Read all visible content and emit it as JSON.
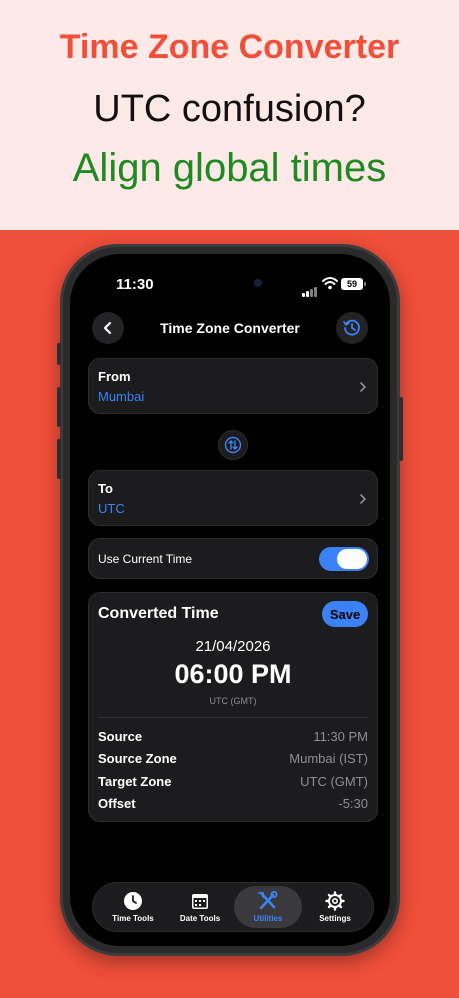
{
  "promo": {
    "line1": "Time Zone Converter",
    "line2": "UTC confusion?",
    "line3": "Align global times"
  },
  "status_bar": {
    "time": "11:30",
    "battery": "59"
  },
  "nav": {
    "title": "Time Zone Converter",
    "back_icon": "chevron-left-icon",
    "history_icon": "history-clock-icon"
  },
  "from": {
    "label": "From",
    "value": "Mumbai"
  },
  "swap_icon": "swap-arrows-icon",
  "to": {
    "label": "To",
    "value": "UTC"
  },
  "use_current_time": {
    "label": "Use Current Time",
    "enabled": true
  },
  "result": {
    "title": "Converted Time",
    "save_label": "Save",
    "date": "21/04/2026",
    "time": "06:00 PM",
    "zone": "UTC (GMT)",
    "details": [
      {
        "key": "Source",
        "value": "11:30 PM"
      },
      {
        "key": "Source Zone",
        "value": "Mumbai (IST)"
      },
      {
        "key": "Target Zone",
        "value": "UTC (GMT)"
      },
      {
        "key": "Offset",
        "value": "-5:30"
      }
    ]
  },
  "tabs": [
    {
      "label": "Time Tools",
      "icon": "clock-icon",
      "active": false
    },
    {
      "label": "Date Tools",
      "icon": "calendar-icon",
      "active": false
    },
    {
      "label": "Utilities",
      "icon": "tools-icon",
      "active": true
    },
    {
      "label": "Settings",
      "icon": "gear-icon",
      "active": false
    }
  ],
  "colors": {
    "accent": "#3b82f6",
    "brand_red": "#f04f3a",
    "promo_green": "#1f8a1f"
  }
}
